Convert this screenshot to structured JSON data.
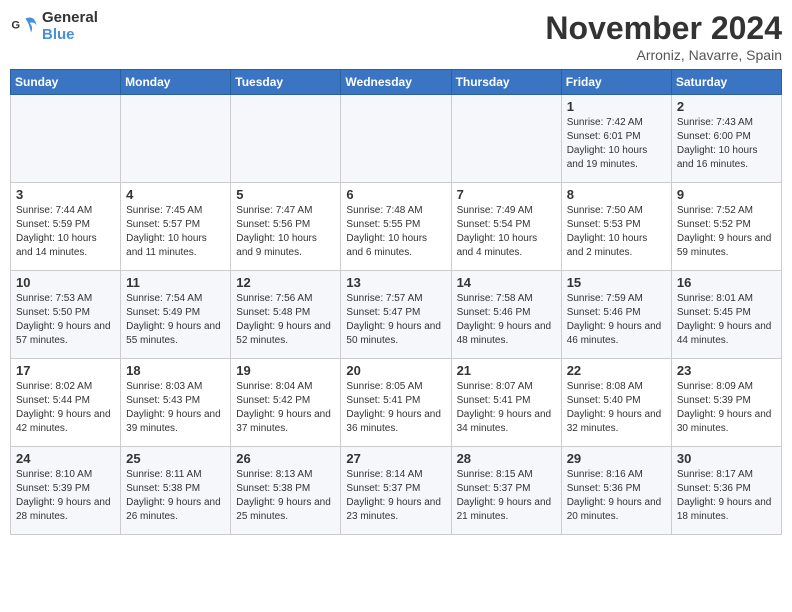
{
  "header": {
    "logo_text_top": "General",
    "logo_text_bottom": "Blue",
    "month_title": "November 2024",
    "subtitle": "Arroniz, Navarre, Spain"
  },
  "calendar": {
    "weekdays": [
      "Sunday",
      "Monday",
      "Tuesday",
      "Wednesday",
      "Thursday",
      "Friday",
      "Saturday"
    ],
    "weeks": [
      [
        {
          "day": "",
          "info": ""
        },
        {
          "day": "",
          "info": ""
        },
        {
          "day": "",
          "info": ""
        },
        {
          "day": "",
          "info": ""
        },
        {
          "day": "",
          "info": ""
        },
        {
          "day": "1",
          "info": "Sunrise: 7:42 AM\nSunset: 6:01 PM\nDaylight: 10 hours and 19 minutes."
        },
        {
          "day": "2",
          "info": "Sunrise: 7:43 AM\nSunset: 6:00 PM\nDaylight: 10 hours and 16 minutes."
        }
      ],
      [
        {
          "day": "3",
          "info": "Sunrise: 7:44 AM\nSunset: 5:59 PM\nDaylight: 10 hours and 14 minutes."
        },
        {
          "day": "4",
          "info": "Sunrise: 7:45 AM\nSunset: 5:57 PM\nDaylight: 10 hours and 11 minutes."
        },
        {
          "day": "5",
          "info": "Sunrise: 7:47 AM\nSunset: 5:56 PM\nDaylight: 10 hours and 9 minutes."
        },
        {
          "day": "6",
          "info": "Sunrise: 7:48 AM\nSunset: 5:55 PM\nDaylight: 10 hours and 6 minutes."
        },
        {
          "day": "7",
          "info": "Sunrise: 7:49 AM\nSunset: 5:54 PM\nDaylight: 10 hours and 4 minutes."
        },
        {
          "day": "8",
          "info": "Sunrise: 7:50 AM\nSunset: 5:53 PM\nDaylight: 10 hours and 2 minutes."
        },
        {
          "day": "9",
          "info": "Sunrise: 7:52 AM\nSunset: 5:52 PM\nDaylight: 9 hours and 59 minutes."
        }
      ],
      [
        {
          "day": "10",
          "info": "Sunrise: 7:53 AM\nSunset: 5:50 PM\nDaylight: 9 hours and 57 minutes."
        },
        {
          "day": "11",
          "info": "Sunrise: 7:54 AM\nSunset: 5:49 PM\nDaylight: 9 hours and 55 minutes."
        },
        {
          "day": "12",
          "info": "Sunrise: 7:56 AM\nSunset: 5:48 PM\nDaylight: 9 hours and 52 minutes."
        },
        {
          "day": "13",
          "info": "Sunrise: 7:57 AM\nSunset: 5:47 PM\nDaylight: 9 hours and 50 minutes."
        },
        {
          "day": "14",
          "info": "Sunrise: 7:58 AM\nSunset: 5:46 PM\nDaylight: 9 hours and 48 minutes."
        },
        {
          "day": "15",
          "info": "Sunrise: 7:59 AM\nSunset: 5:46 PM\nDaylight: 9 hours and 46 minutes."
        },
        {
          "day": "16",
          "info": "Sunrise: 8:01 AM\nSunset: 5:45 PM\nDaylight: 9 hours and 44 minutes."
        }
      ],
      [
        {
          "day": "17",
          "info": "Sunrise: 8:02 AM\nSunset: 5:44 PM\nDaylight: 9 hours and 42 minutes."
        },
        {
          "day": "18",
          "info": "Sunrise: 8:03 AM\nSunset: 5:43 PM\nDaylight: 9 hours and 39 minutes."
        },
        {
          "day": "19",
          "info": "Sunrise: 8:04 AM\nSunset: 5:42 PM\nDaylight: 9 hours and 37 minutes."
        },
        {
          "day": "20",
          "info": "Sunrise: 8:05 AM\nSunset: 5:41 PM\nDaylight: 9 hours and 36 minutes."
        },
        {
          "day": "21",
          "info": "Sunrise: 8:07 AM\nSunset: 5:41 PM\nDaylight: 9 hours and 34 minutes."
        },
        {
          "day": "22",
          "info": "Sunrise: 8:08 AM\nSunset: 5:40 PM\nDaylight: 9 hours and 32 minutes."
        },
        {
          "day": "23",
          "info": "Sunrise: 8:09 AM\nSunset: 5:39 PM\nDaylight: 9 hours and 30 minutes."
        }
      ],
      [
        {
          "day": "24",
          "info": "Sunrise: 8:10 AM\nSunset: 5:39 PM\nDaylight: 9 hours and 28 minutes."
        },
        {
          "day": "25",
          "info": "Sunrise: 8:11 AM\nSunset: 5:38 PM\nDaylight: 9 hours and 26 minutes."
        },
        {
          "day": "26",
          "info": "Sunrise: 8:13 AM\nSunset: 5:38 PM\nDaylight: 9 hours and 25 minutes."
        },
        {
          "day": "27",
          "info": "Sunrise: 8:14 AM\nSunset: 5:37 PM\nDaylight: 9 hours and 23 minutes."
        },
        {
          "day": "28",
          "info": "Sunrise: 8:15 AM\nSunset: 5:37 PM\nDaylight: 9 hours and 21 minutes."
        },
        {
          "day": "29",
          "info": "Sunrise: 8:16 AM\nSunset: 5:36 PM\nDaylight: 9 hours and 20 minutes."
        },
        {
          "day": "30",
          "info": "Sunrise: 8:17 AM\nSunset: 5:36 PM\nDaylight: 9 hours and 18 minutes."
        }
      ]
    ]
  }
}
